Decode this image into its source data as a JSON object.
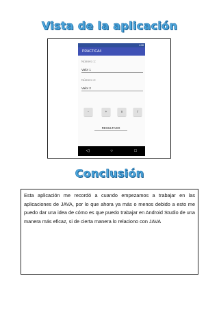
{
  "headings": {
    "view": "Vista de la aplicación",
    "conclusion": "Conclusión"
  },
  "phone": {
    "status_time": "4:08",
    "app_title": "PRACTICA4",
    "field1": {
      "label": "Número 1:",
      "value": "Valor 1"
    },
    "field2": {
      "label": "Número 2:",
      "value": "Valor 2"
    },
    "operations": [
      "-",
      "+",
      "x",
      "/"
    ],
    "result_label": "RESULTADO",
    "nav": {
      "back": "◁",
      "home": "○",
      "recent": "□"
    },
    "colors": {
      "app_bar": "#3f51b5",
      "status_bar": "#2f4f9a"
    }
  },
  "conclusion_text": "Esta aplicación me recordó a cuando empezamos a trabajar en las aplicaciones de JAVA, por lo que ahora ya más o menos debido a esto me puedo dar una idea de cómo es que puedo trabajar en Android Studio de una manera más eficaz, si de cierta manera lo relaciono con JAVA"
}
